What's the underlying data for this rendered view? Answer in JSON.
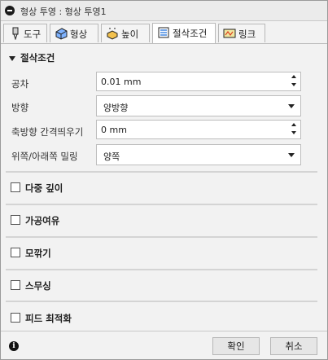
{
  "window": {
    "title": "형상 투영 : 형상 투영1"
  },
  "tabs": [
    {
      "label": "도구",
      "icon": "tool-icon"
    },
    {
      "label": "형상",
      "icon": "shape-icon"
    },
    {
      "label": "높이",
      "icon": "height-icon"
    },
    {
      "label": "절삭조건",
      "icon": "passes-icon",
      "active": true
    },
    {
      "label": "링크",
      "icon": "linking-icon"
    }
  ],
  "passes": {
    "heading": "절삭조건",
    "tolerance": {
      "label": "공차",
      "value": "0.01 mm"
    },
    "direction": {
      "label": "방향",
      "value": "양방향"
    },
    "stepover": {
      "label": "축방향 간격띄우기",
      "value": "0 mm"
    },
    "milling": {
      "label": "위쪽/아래쪽 밀링",
      "value": "양쪽"
    }
  },
  "groups": [
    {
      "label": "다중 깊이",
      "checked": false
    },
    {
      "label": "가공여유",
      "checked": false
    },
    {
      "label": "모깎기",
      "checked": false
    },
    {
      "label": "스무싱",
      "checked": false
    },
    {
      "label": "피드 최적화",
      "checked": false
    }
  ],
  "footer": {
    "ok_label": "확인",
    "cancel_label": "취소"
  },
  "colors": {
    "active_tab": "#ffffff",
    "window_bg": "#f2f2f2",
    "border": "#9a9a9a"
  }
}
